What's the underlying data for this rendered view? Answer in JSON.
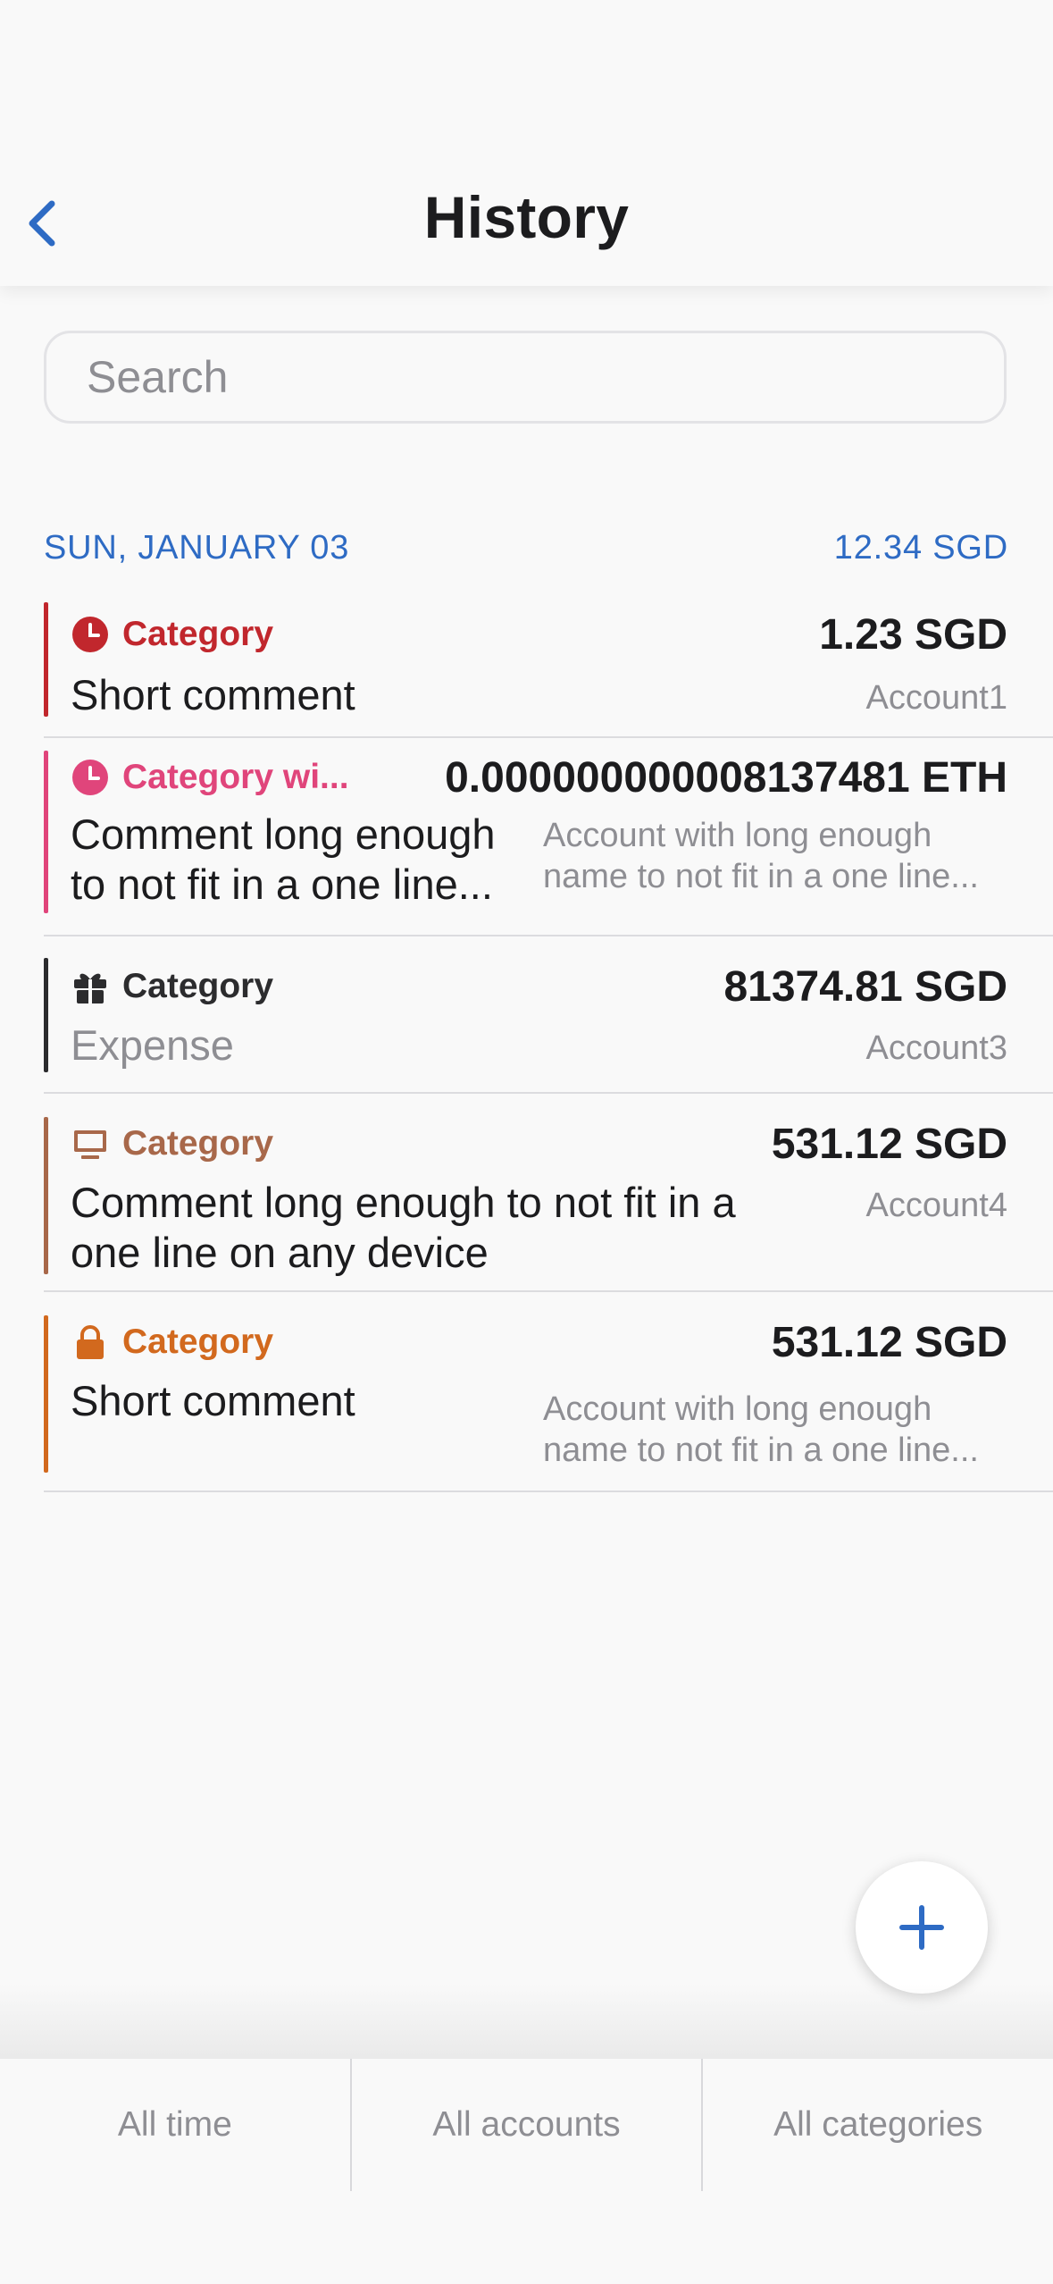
{
  "nav": {
    "title": "History",
    "back_icon": "chevron-left-icon"
  },
  "search": {
    "placeholder": "Search",
    "value": ""
  },
  "section": {
    "date": "SUN, JANUARY 03",
    "total": "12.34 SGD"
  },
  "transactions": [
    {
      "category": "Category",
      "icon": "clock-icon",
      "color": "#c1272d",
      "amount": "1.23 SGD",
      "comment": "Short comment",
      "account": "Account1"
    },
    {
      "category": "Category wi...",
      "icon": "clock-icon",
      "color": "#e0457b",
      "amount": "0.000000000008137481 ETH",
      "comment": "Comment long enough to not fit in a one line...",
      "account": "Account with long enough name to not fit in a one line..."
    },
    {
      "category": "Category",
      "icon": "gift-icon",
      "color": "#2c2c2e",
      "amount": "81374.81 SGD",
      "comment": "Expense",
      "account": "Account3"
    },
    {
      "category": "Category",
      "icon": "monitor-icon",
      "color": "#a8684a",
      "amount": "531.12 SGD",
      "comment": "Comment long enough to not fit in a one line on any device",
      "account": "Account4"
    },
    {
      "category": "Category",
      "icon": "lock-icon",
      "color": "#d2691e",
      "amount": "531.12 SGD",
      "comment": "Short comment",
      "account": "Account with long enough name to not fit in a one line..."
    }
  ],
  "fab": {
    "icon": "plus-icon"
  },
  "filters": {
    "time": "All time",
    "accounts": "All accounts",
    "categories": "All categories"
  },
  "colors": {
    "accent": "#2e6bc4",
    "background": "#f9f9f9",
    "secondary_text": "#8e8e93"
  }
}
